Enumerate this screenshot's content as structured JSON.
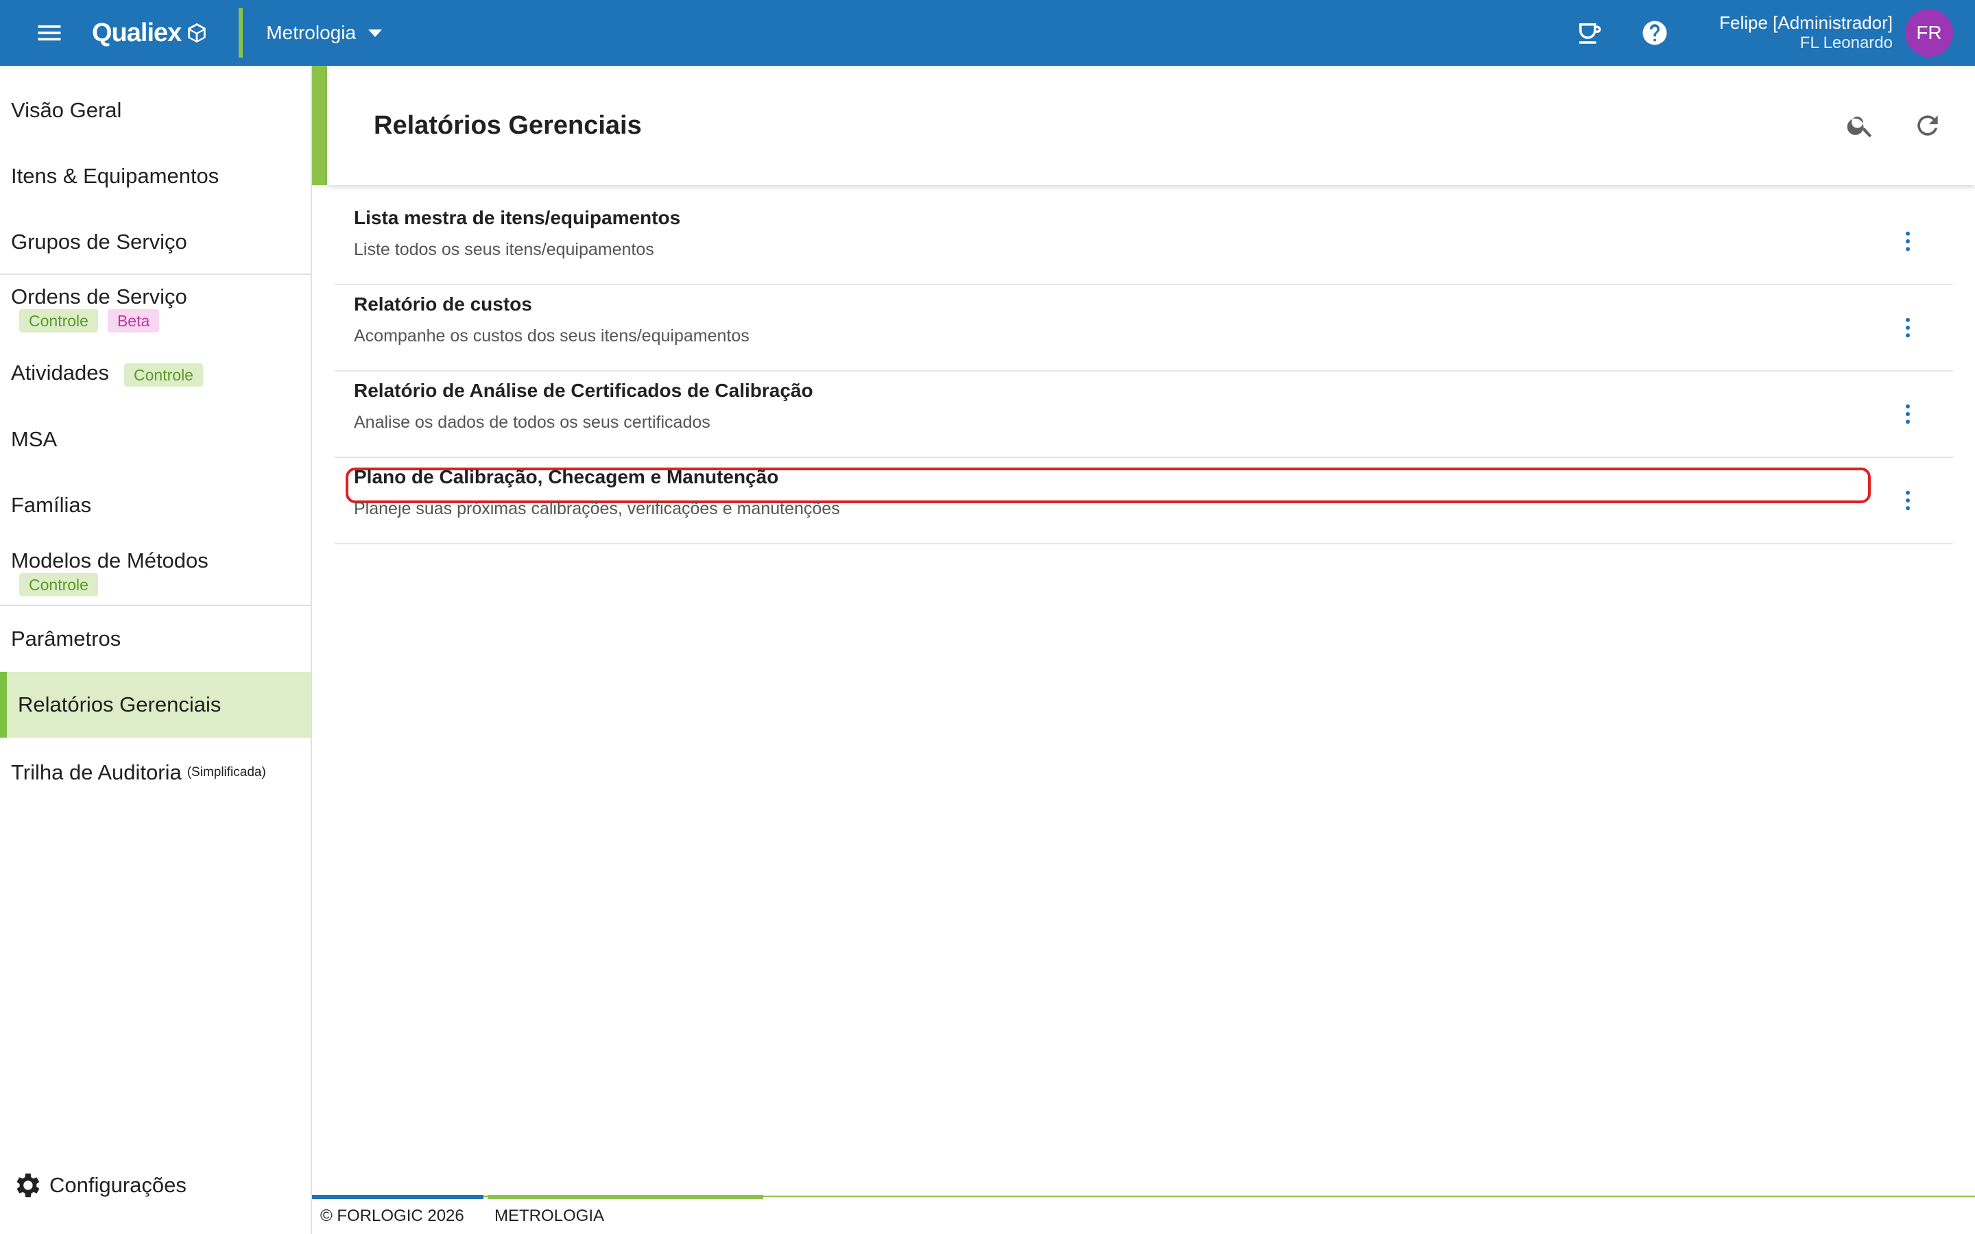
{
  "topbar": {
    "logo_text": "Qualiex",
    "module": "Metrologia",
    "user_name": "Felipe [Administrador]",
    "user_org": "FL Leonardo",
    "avatar_initials": "FR",
    "brand_color": "#1f73b7",
    "accent_color": "#8bc34a",
    "avatar_color": "#9c36b5"
  },
  "sidebar": {
    "items": [
      {
        "label": "Visão Geral"
      },
      {
        "label": "Itens & Equipamentos"
      },
      {
        "label": "Grupos de Serviço"
      },
      {
        "label": "Ordens de Serviço",
        "badges": [
          "Controle",
          "Beta"
        ]
      },
      {
        "label": "Atividades",
        "badges": [
          "Controle"
        ]
      },
      {
        "label": "MSA"
      },
      {
        "label": "Famílias"
      },
      {
        "label": "Modelos de Métodos",
        "badges": [
          "Controle"
        ]
      },
      {
        "label": "Parâmetros"
      },
      {
        "label": "Relatórios Gerenciais",
        "active": true
      },
      {
        "label": "Trilha de Auditoria",
        "note": "(Simplificada)"
      }
    ],
    "settings_label": "Configurações"
  },
  "main": {
    "title": "Relatórios Gerenciais",
    "reports": [
      {
        "title": "Lista mestra de itens/equipamentos",
        "description": "Liste todos os seus itens/equipamentos"
      },
      {
        "title": "Relatório de custos",
        "description": "Acompanhe os custos dos seus itens/equipamentos"
      },
      {
        "title": "Relatório de Análise de Certificados de Calibração",
        "description": "Analise os dados de todos os seus certificados"
      },
      {
        "title": "Plano de Calibração, Checagem e Manutenção",
        "description": "Planeje suas próximas calibrações, verificações e manutenções",
        "highlighted": true
      }
    ]
  },
  "footer": {
    "copyright": "© FORLOGIC 2026",
    "module": "METROLOGIA"
  }
}
